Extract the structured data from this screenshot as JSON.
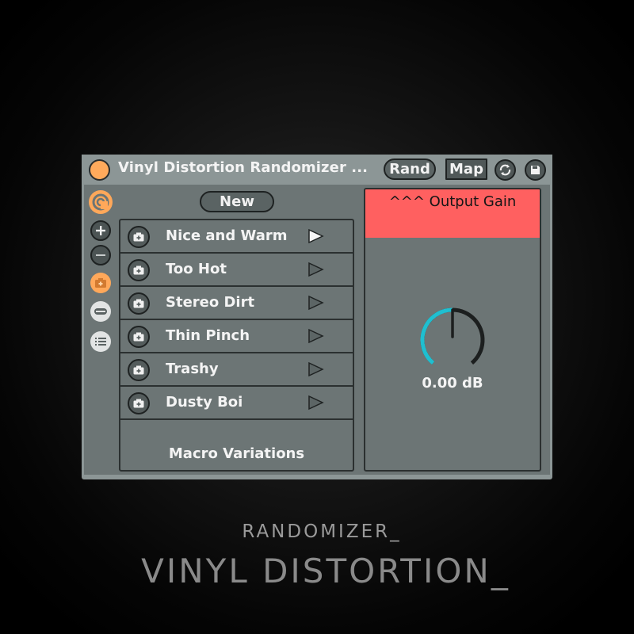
{
  "device": {
    "title": "Vinyl Distortion Randomizer ...",
    "toggle_on": true,
    "buttons": {
      "rand": "Rand",
      "map": "Map"
    },
    "icons": {
      "sync": "sync-icon",
      "save": "save-icon"
    }
  },
  "sidebar": {
    "items": [
      {
        "icon": "power-hot-swap-icon",
        "active": true
      },
      {
        "icon": "plus-icon",
        "active": false
      },
      {
        "icon": "minus-icon",
        "active": false
      },
      {
        "icon": "snapshot-icon",
        "active": true
      },
      {
        "icon": "collapse-icon",
        "active": false
      },
      {
        "icon": "list-icon",
        "active": false
      }
    ]
  },
  "variations": {
    "new_label": "New",
    "items": [
      {
        "label": "Nice and Warm",
        "active": true
      },
      {
        "label": "Too Hot",
        "active": false
      },
      {
        "label": "Stereo Dirt",
        "active": false
      },
      {
        "label": "Thin Pinch",
        "active": false
      },
      {
        "label": "Trashy",
        "active": false
      },
      {
        "label": "Dusty Boi",
        "active": false
      }
    ],
    "footer_label": "Macro Variations"
  },
  "output_gain": {
    "title": "^^^ Output Gain",
    "value_text": "0.00 dB",
    "knob_fraction": 0.5,
    "header_color": "#ff6060",
    "knob_color": "#1fbfd0"
  },
  "caption": {
    "subtitle": "RANDOMIZER_",
    "title": "VINYL DISTORTION_"
  }
}
